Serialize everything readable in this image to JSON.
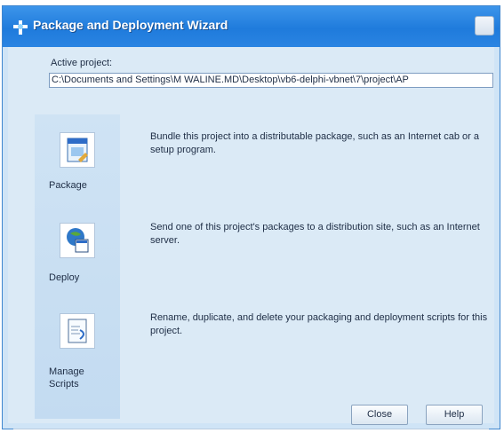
{
  "window": {
    "title": "Package and Deployment Wizard"
  },
  "project": {
    "label": "Active project:",
    "path": "C:\\Documents and Settings\\M WALINE.MD\\Desktop\\vb6-delphi-vbnet\\7\\project\\AP"
  },
  "commands": [
    {
      "label": "Package",
      "description": "Bundle this project into a distributable package, such as an Internet cab or a setup program.",
      "icon": "package-icon"
    },
    {
      "label": "Deploy",
      "description": "Send one of this project's packages to a distribution site, such as an Internet server.",
      "icon": "deploy-icon"
    },
    {
      "label_line1": "Manage",
      "label_line2": "Scripts",
      "description": "Rename, duplicate, and delete your packaging and deployment scripts for this project.",
      "icon": "manage-scripts-icon"
    }
  ],
  "buttons": {
    "close": "Close",
    "help": "Help"
  },
  "colors": {
    "titlebar": "#1f7bdc",
    "client": "#dbeaf6",
    "sidebar": "#c3dbf1"
  }
}
